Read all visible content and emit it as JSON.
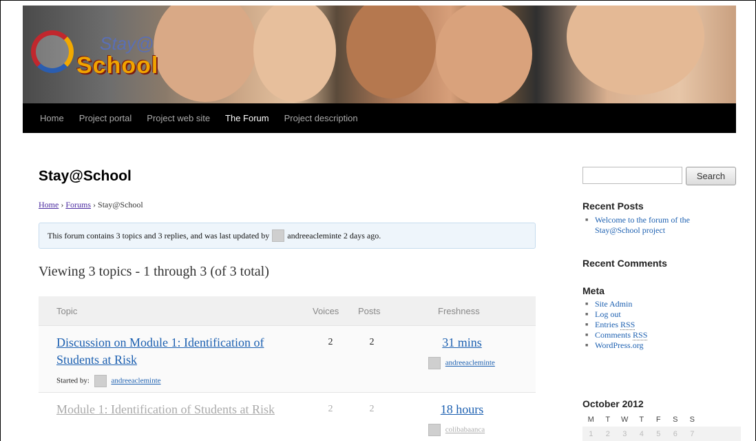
{
  "header": {
    "logo_text_top": "Stay@",
    "logo_text_bottom": "School"
  },
  "nav": {
    "items": [
      {
        "label": "Home"
      },
      {
        "label": "Project portal"
      },
      {
        "label": "Project web site"
      },
      {
        "label": "The Forum"
      },
      {
        "label": "Project description"
      }
    ],
    "active_index": 3
  },
  "main": {
    "title": "Stay@School",
    "breadcrumb": {
      "home": "Home",
      "sep": "›",
      "forums": "Forums",
      "current": "Stay@School"
    },
    "info": {
      "prefix": "This forum contains 3 topics and 3 replies, and was last updated by",
      "user": "andreeacleminte",
      "suffix": "2 days ago."
    },
    "viewing": "Viewing 3 topics - 1 through 3 (of 3 total)",
    "table": {
      "headers": {
        "topic": "Topic",
        "voices": "Voices",
        "posts": "Posts",
        "freshness": "Freshness"
      },
      "rows": [
        {
          "title": "Discussion on Module 1: Identification of Students at Risk",
          "started_label": "Started by:",
          "author": "andreeacleminte",
          "voices": "2",
          "posts": "2",
          "freshness": "31 mins",
          "fresh_user": "andreeacleminte"
        },
        {
          "title": "Module 1: Identification of Students at Risk",
          "voices": "2",
          "posts": "2",
          "freshness": "18 hours",
          "fresh_user": "colibabaanca"
        }
      ]
    }
  },
  "sidebar": {
    "search": {
      "placeholder": "",
      "button": "Search"
    },
    "recent_posts": {
      "heading": "Recent Posts",
      "items": [
        "Welcome to the forum of the Stay@School project"
      ]
    },
    "recent_comments": {
      "heading": "Recent Comments"
    },
    "meta": {
      "heading": "Meta",
      "items": [
        {
          "label": "Site Admin"
        },
        {
          "label": "Log out"
        },
        {
          "label_pre": "Entries ",
          "label_abbr": "RSS"
        },
        {
          "label_pre": "Comments ",
          "label_abbr": "RSS"
        },
        {
          "label": "WordPress.org"
        }
      ]
    },
    "calendar": {
      "heading": "October 2012",
      "weekdays": [
        "M",
        "T",
        "W",
        "T",
        "F",
        "S",
        "S"
      ],
      "days": [
        "1",
        "2",
        "3",
        "4",
        "5",
        "6",
        "7"
      ]
    }
  }
}
